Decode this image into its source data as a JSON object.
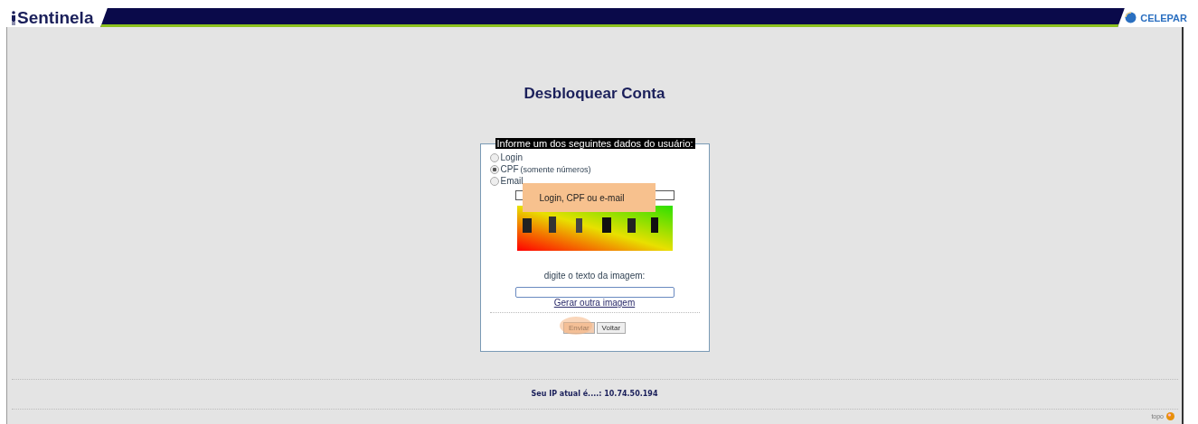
{
  "header": {
    "logo": "Sentinela",
    "partner": "CELEPAR"
  },
  "title": "Desbloquear Conta",
  "form": {
    "legend": "Informe um dos seguintes dados do usuário:",
    "options": [
      {
        "label": "Login",
        "selected": false
      },
      {
        "label": "CPF",
        "note": "(somente números)",
        "selected": true
      },
      {
        "label": "Email",
        "selected": false
      }
    ],
    "callout": "Login, CPF ou e-mail",
    "captcha_prompt": "digite o texto da imagem:",
    "regenerate_link": "Gerar outra imagem",
    "buttons": [
      {
        "label": "Enviar",
        "highlighted": true
      },
      {
        "label": "Voltar",
        "highlighted": false
      }
    ]
  },
  "footer": {
    "ip_text": "Seu IP atual é....: 10.74.50.194",
    "top_link": "topo"
  }
}
